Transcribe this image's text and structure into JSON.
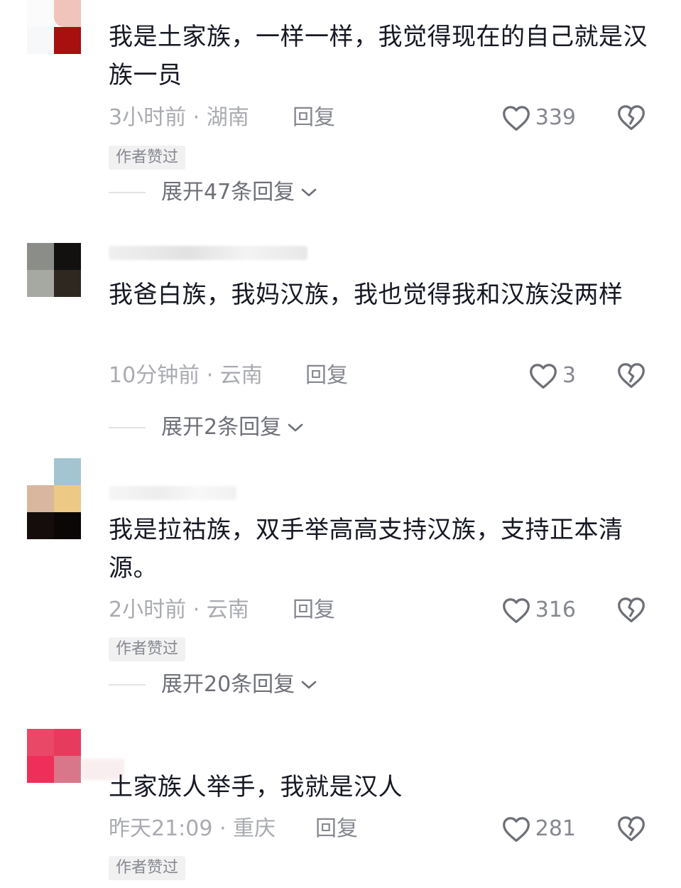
{
  "comments": [
    {
      "text": "我是土家族，一样一样，我觉得现在的自己就是汉族一员",
      "time_location": "3小时前 · 湖南",
      "reply_label": "回复",
      "likes": "339",
      "author_badge": "作者赞过",
      "expand_label": "展开47条回复"
    },
    {
      "text": "我爸白族，我妈汉族，我也觉得我和汉族没两样",
      "time_location": "10分钟前 · 云南",
      "reply_label": "回复",
      "likes": "3",
      "expand_label": "展开2条回复"
    },
    {
      "text": "我是拉祜族，双手举高高支持汉族，支持正本清源。",
      "time_location": "2小时前 · 云南",
      "reply_label": "回复",
      "likes": "316",
      "author_badge": "作者赞过",
      "expand_label": "展开20条回复"
    },
    {
      "text": "土家族人举手，我就是汉人",
      "time_location": "昨天21:09 · 重庆",
      "reply_label": "回复",
      "likes": "281",
      "author_badge": "作者赞过"
    }
  ],
  "icons": {
    "like": "heart-outline-icon",
    "dislike": "broken-heart-icon",
    "expand": "chevron-down-icon"
  },
  "colors": {
    "text": "#161823",
    "meta": "#a9abb0",
    "secondary": "#86888f",
    "badge_bg": "#f1f1f2"
  }
}
